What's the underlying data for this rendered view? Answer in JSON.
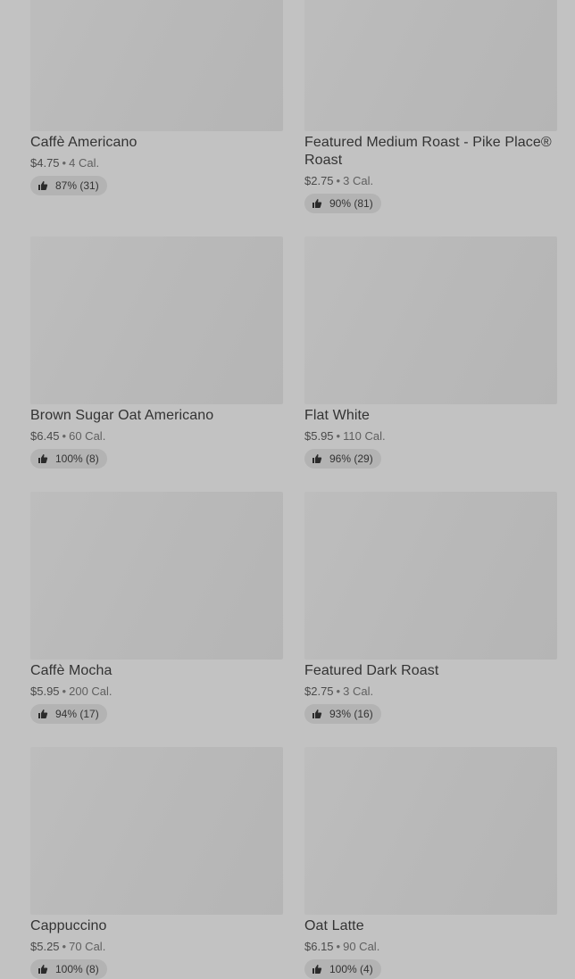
{
  "products": [
    {
      "name": "Caffè Americano",
      "price": "$4.75",
      "calories": "4 Cal.",
      "rating": "87% (31)"
    },
    {
      "name": "Featured Medium Roast - Pike Place® Roast",
      "price": "$2.75",
      "calories": "3 Cal.",
      "rating": "90% (81)"
    },
    {
      "name": "Brown Sugar Oat Americano",
      "price": "$6.45",
      "calories": "60 Cal.",
      "rating": "100% (8)"
    },
    {
      "name": "Flat White",
      "price": "$5.95",
      "calories": "110 Cal.",
      "rating": "96% (29)"
    },
    {
      "name": "Caffè Mocha",
      "price": "$5.95",
      "calories": "200 Cal.",
      "rating": "94% (17)"
    },
    {
      "name": "Featured Dark Roast",
      "price": "$2.75",
      "calories": "3 Cal.",
      "rating": "93% (16)"
    },
    {
      "name": "Cappuccino",
      "price": "$5.25",
      "calories": "70 Cal.",
      "rating": "100% (8)"
    },
    {
      "name": "Oat Latte",
      "price": "$6.15",
      "calories": "90 Cal.",
      "rating": "100% (4)"
    }
  ],
  "separator": "•",
  "icons": {
    "rating": "thumbs-up-icon"
  }
}
